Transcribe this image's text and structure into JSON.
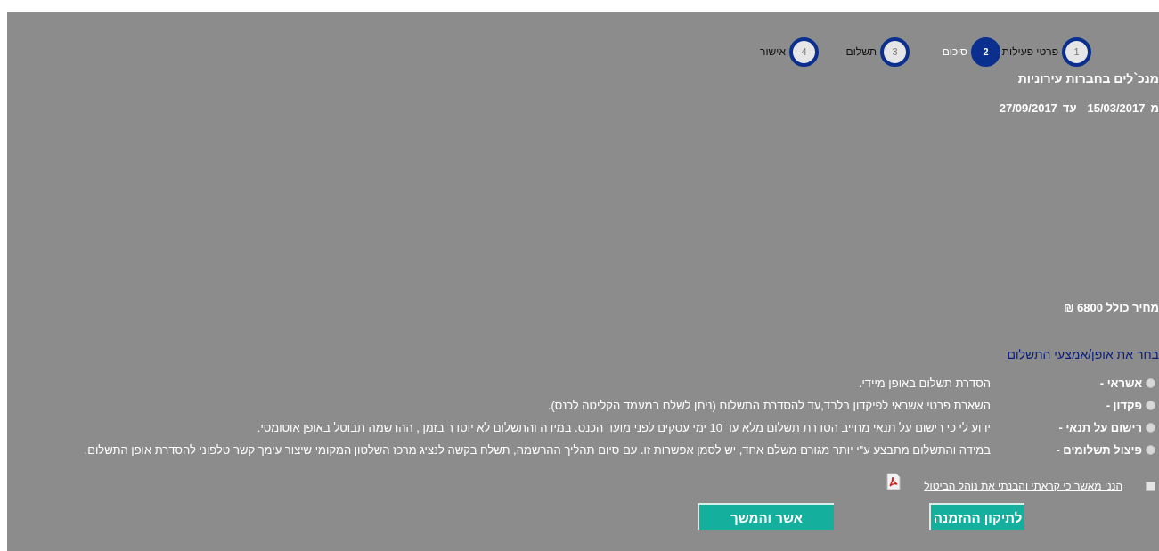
{
  "steps": [
    {
      "number": "1",
      "label": "פרטי פעילות",
      "selected": false
    },
    {
      "number": "2",
      "label": "סיכום",
      "selected": true
    },
    {
      "number": "3",
      "label": "תשלום",
      "selected": false
    },
    {
      "number": "4",
      "label": "אישור",
      "selected": false
    }
  ],
  "title": "מנכ`לים בחברות עירוניות",
  "dates": {
    "from_prefix": "מ",
    "from": "15/03/2017",
    "to_prefix": "עד",
    "to": "27/09/2017"
  },
  "price": "מחיר כולל 6800 ₪",
  "payment_heading": "בחר את אופן/אמצעי התשלום",
  "payment_options": [
    {
      "label": "אשראי -",
      "description": "הסדרת תשלום באופן מיידי.",
      "selected": false
    },
    {
      "label": "פקדון -",
      "description": "השארת פרטי אשראי לפיקדון בלבד,עד להסדרת התשלום (ניתן לשלם במעמד הקליטה לכנס).",
      "selected": false
    },
    {
      "label": "רישום על תנאי -",
      "description": "ידוע לי כי רישום על תנאי מחייב הסדרת תשלום מלא עד 10 ימי עסקים לפני מועד הכנס. במידה והתשלום לא יוסדר בזמן , ההרשמה תבוטל באופן אוטומטי.",
      "selected": false
    },
    {
      "label": "פיצול תשלומים -",
      "description": "במידה והתשלום מתבצע ע\"י יותר מגורם משלם אחד, יש לסמן אפשרות זו. עם סיום תהליך ההרשמה, תשלח בקשה לנציג מרכז השלטון המקומי שיצור עימך קשר טלפוני להסדרת אופן התשלום.",
      "selected": false
    }
  ],
  "terms": {
    "label": "הנני מאשר כי קראתי והבנתי את נוהל הביטול",
    "checked": false
  },
  "buttons": [
    "לתיקון ההזמנה",
    "אשר והמשך"
  ]
}
